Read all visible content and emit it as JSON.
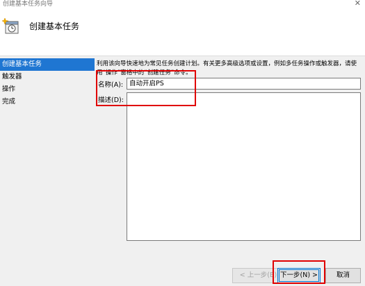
{
  "window": {
    "title": "创建基本任务向导",
    "close_glyph": "✕"
  },
  "header": {
    "title": "创建基本任务",
    "icon": "task-scheduler-icon"
  },
  "sidebar": {
    "items": [
      {
        "label": "创建基本任务",
        "active": true
      },
      {
        "label": "触发器",
        "active": false
      },
      {
        "label": "操作",
        "active": false
      },
      {
        "label": "完成",
        "active": false
      }
    ]
  },
  "main": {
    "description": "利用该向导快速地为常见任务创建计划。有关更多高级选项或设置，例如多任务操作或触发器，请使用“操作”窗格中的“创建任务”命令。",
    "name_label": "名称(A):",
    "name_value": "自动开启PS",
    "desc_label": "描述(D):",
    "desc_value": ""
  },
  "buttons": {
    "back": "< 上一步(B)",
    "next": "下一步(N) >",
    "cancel": "取消"
  },
  "colors": {
    "accent": "#1f76d2",
    "highlight": "#e00000"
  }
}
